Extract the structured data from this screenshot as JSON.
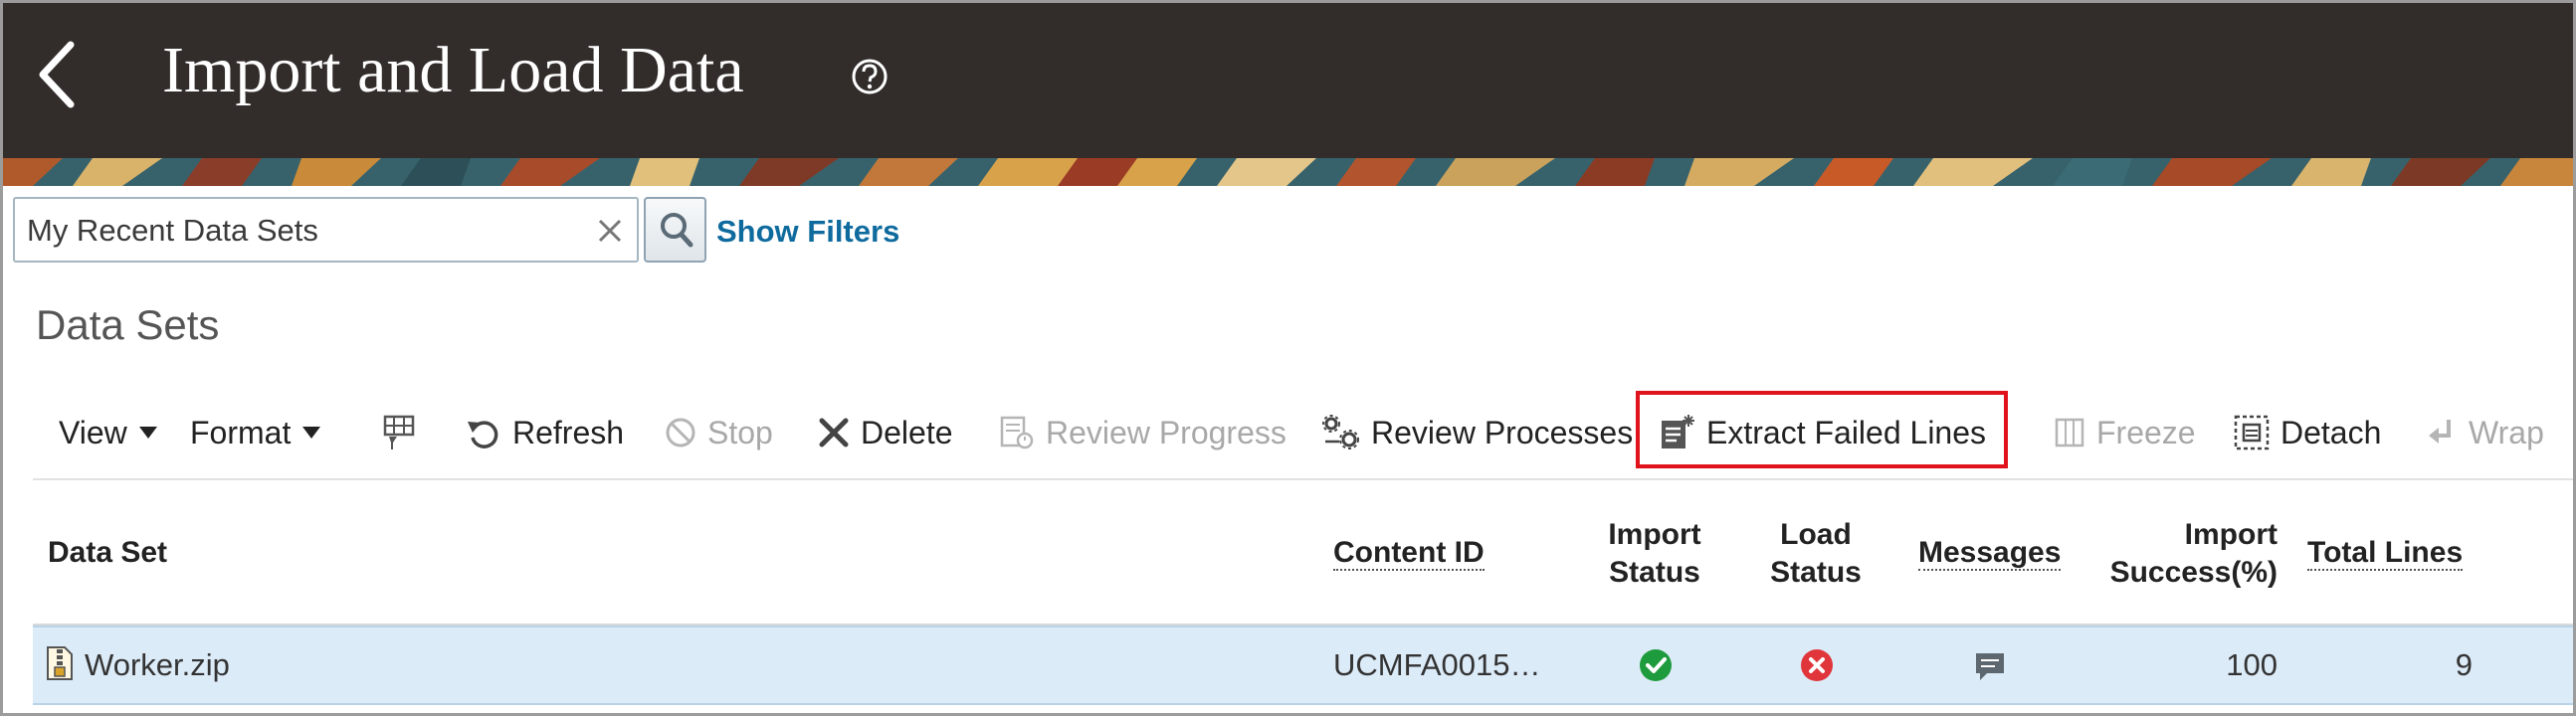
{
  "header": {
    "title": "Import and Load Data"
  },
  "search": {
    "value": "My Recent Data Sets",
    "show_filters_label": "Show Filters"
  },
  "section": {
    "title": "Data Sets"
  },
  "toolbar": {
    "view_label": "View",
    "format_label": "Format",
    "refresh_label": "Refresh",
    "stop_label": "Stop",
    "delete_label": "Delete",
    "review_progress_label": "Review Progress",
    "review_processes_label": "Review Processes",
    "extract_failed_lines_label": "Extract Failed Lines",
    "freeze_label": "Freeze",
    "detach_label": "Detach",
    "wrap_label": "Wrap"
  },
  "table": {
    "columns": {
      "data_set": "Data Set",
      "content_id": "Content ID",
      "import_status_1": "Import",
      "import_status_2": "Status",
      "load_status_1": "Load",
      "load_status_2": "Status",
      "messages": "Messages",
      "import_success_1": "Import",
      "import_success_2": "Success(%)",
      "total_lines": "Total Lines"
    },
    "rows": [
      {
        "data_set": "Worker.zip",
        "content_id": "UCMFA0015…",
        "import_status": "success",
        "load_status": "error",
        "import_success": "100",
        "total_lines": "9"
      }
    ]
  },
  "colors": {
    "header_bg": "#322d2b",
    "link": "#0f6b9e",
    "highlight": "#e0121b",
    "selected_row": "#dcebf8",
    "success": "#1e9b3c",
    "error": "#e0353a"
  },
  "icons": {
    "back": "chevron-left-icon",
    "help": "help-circle-icon",
    "clear": "close-icon",
    "search": "search-icon",
    "refresh": "refresh-icon",
    "stop": "stop-icon",
    "delete": "delete-x-icon",
    "review_progress": "review-progress-icon",
    "review_processes": "review-processes-icon",
    "extract_failed_lines": "extract-lines-icon",
    "freeze": "freeze-icon",
    "detach": "detach-icon",
    "wrap": "wrap-icon",
    "zip_file": "zip-file-icon",
    "messages": "chat-bubble-icon"
  }
}
